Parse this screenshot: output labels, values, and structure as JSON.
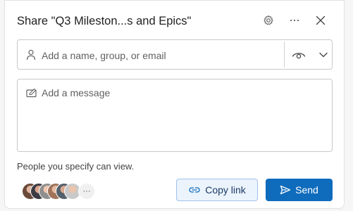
{
  "dialog": {
    "title": "Share \"Q3 Mileston...s and Epics\""
  },
  "header": {
    "settings_icon": "gear-icon",
    "more_icon": "ellipsis-icon",
    "close_icon": "close-icon"
  },
  "recipients": {
    "placeholder": "Add a name, group, or email",
    "icon": "person-icon",
    "permission_icon": "eye-icon",
    "permission_chevron": "chevron-down-icon"
  },
  "message": {
    "placeholder": "Add a message",
    "icon": "edit-icon"
  },
  "permission_note": "People you specify can view.",
  "avatars": {
    "count_shown": 6,
    "more_label": "···"
  },
  "buttons": {
    "copy_link": "Copy link",
    "send": "Send"
  },
  "colors": {
    "primary": "#0f6cbd",
    "copy_bg": "#ebf3fc",
    "border": "#c8c8c8"
  }
}
